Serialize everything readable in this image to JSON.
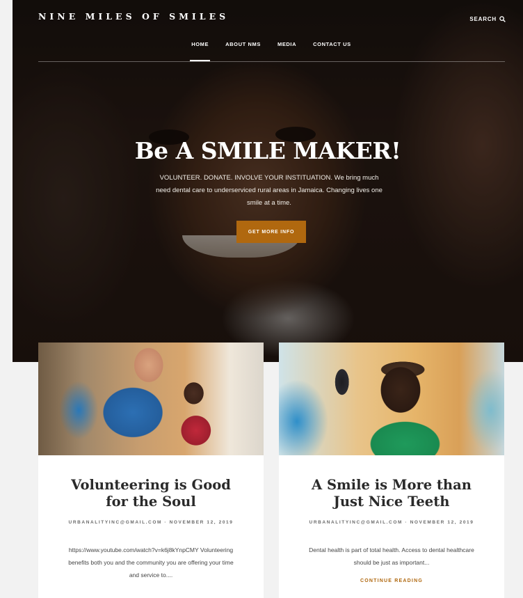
{
  "site": {
    "brand": "NINE MILES OF SMILES",
    "search_label": "SEARCH"
  },
  "nav": {
    "items": [
      {
        "label": "HOME",
        "active": true
      },
      {
        "label": "ABOUT NMS",
        "active": false
      },
      {
        "label": "MEDIA",
        "active": false
      },
      {
        "label": "CONTACT US",
        "active": false
      }
    ]
  },
  "hero": {
    "title": "Be A SMILE MAKER!",
    "text": "VOLUNTEER. DONATE. INVOLVE YOUR INSTITUATION. We bring much need dental care to underserviced rural areas in Jamaica. Changing lives one smile at a time.",
    "button_label": "GET MORE INFO"
  },
  "posts": [
    {
      "title": "Volunteering is Good for the Soul",
      "meta": "URBANALITYINC@GMAIL.COM · NOVEMBER 12, 2019",
      "excerpt": "https://www.youtube.com/watch?v=k6j8kYnpCMY Volunteering benefits both you and the community you are offering your time and service to....",
      "link_label": ""
    },
    {
      "title": "A Smile is More than Just Nice Teeth",
      "meta": "URBANALITYINC@GMAIL.COM · NOVEMBER 12, 2019",
      "excerpt": "Dental health is part of total health. Access to dental healthcare should be just as important...",
      "link_label": "CONTINUE READING"
    }
  ],
  "colors": {
    "accent": "#b0680f",
    "page_bg": "#f2f2f2",
    "card_bg": "#ffffff"
  }
}
